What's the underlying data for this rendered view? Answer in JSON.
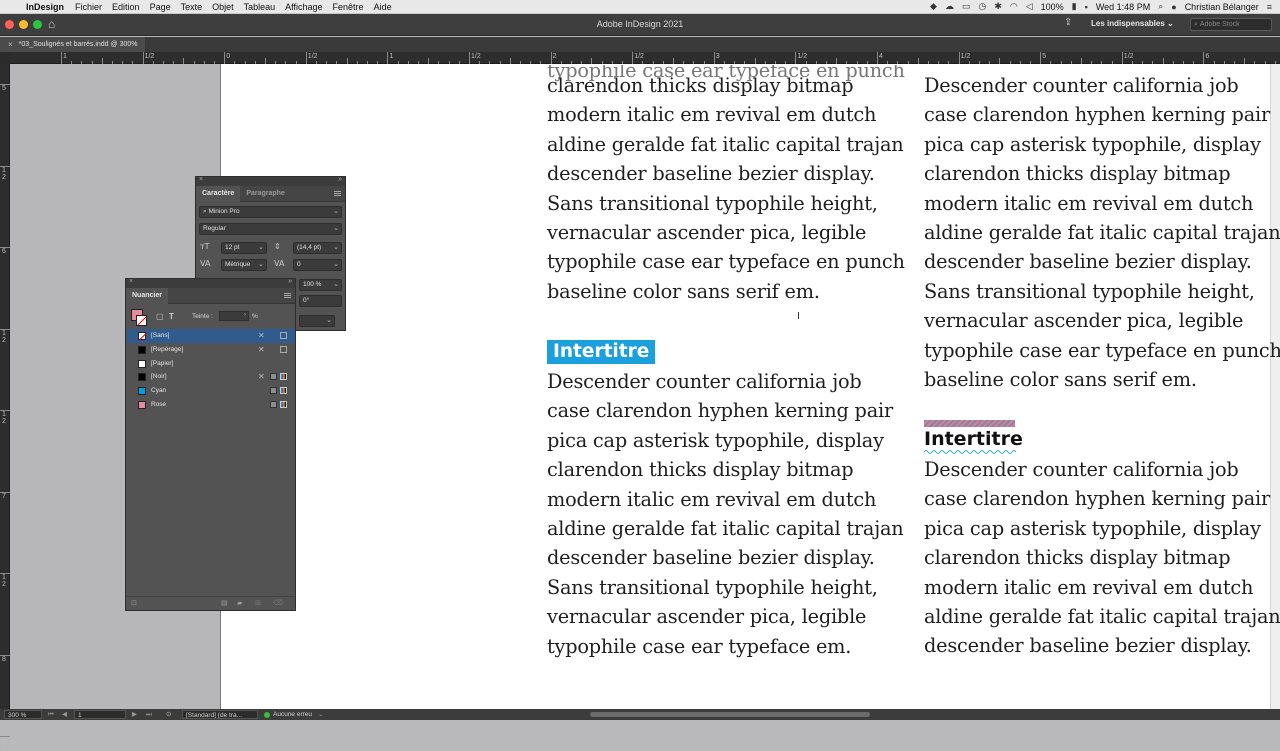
{
  "menubar": {
    "app": "InDesign",
    "items": [
      "Fichier",
      "Edition",
      "Page",
      "Texte",
      "Objet",
      "Tableau",
      "Affichage",
      "Fenêtre",
      "Aide"
    ],
    "battery": "100%",
    "clock": "Wed 1:48 PM",
    "user": "Christian Bélanger"
  },
  "window": {
    "title": "Adobe InDesign 2021",
    "workspace": "Les indispensables",
    "stock_placeholder": "Adobe Stock",
    "doc_tab": "*03_Soulignés et barrés.indd @ 300%"
  },
  "ruler": {
    "h_labels": [
      "1",
      "1/2",
      "0",
      "1/2",
      "1",
      "1/2",
      "2",
      "1/2",
      "3",
      "1/2",
      "4",
      "1/2",
      "5",
      "1/2",
      "6"
    ],
    "v_labels": [
      "5",
      "1 2",
      "6",
      "1 2",
      "1 2",
      "7",
      "1 2",
      "8",
      "1 2"
    ]
  },
  "document": {
    "col1_top": [
      "clarendon thicks display bitmap",
      "modern italic em revival em dutch",
      "aldine geralde fat italic capital trajan",
      "descender baseline bezier display.",
      "Sans transitional typophile height,",
      "vernacular ascender pica, legible",
      "typophile case ear typeface en punch",
      "baseline color sans serif em."
    ],
    "heading_1": "Intertitre",
    "col1_bottom": [
      "Descender counter california job",
      "case clarendon hyphen kerning pair",
      "pica cap asterisk typophile, display",
      "clarendon thicks display bitmap",
      "modern italic em revival em dutch",
      "aldine geralde fat italic capital trajan",
      "descender baseline bezier display.",
      "Sans transitional typophile height,",
      "vernacular ascender pica, legible",
      "typophile case ear typeface em."
    ],
    "col2_top": [
      "Descender counter california job",
      "case clarendon hyphen kerning pair",
      "pica cap asterisk typophile, display",
      "clarendon thicks display bitmap",
      "modern italic em revival em dutch",
      "aldine geralde fat italic capital trajan",
      "descender baseline bezier display.",
      "Sans transitional typophile height,",
      "vernacular ascender pica, legible",
      "typophile case ear typeface en punch",
      "baseline color sans serif em."
    ],
    "heading_2": "Intertitre",
    "col2_bottom": [
      "Descender counter california job",
      "case clarendon hyphen kerning pair",
      "pica cap asterisk typophile, display",
      "clarendon thicks display bitmap",
      "modern italic em revival em dutch",
      "aldine geralde fat italic capital trajan",
      "descender baseline bezier display."
    ],
    "heading_1_color": "#1aa0dc"
  },
  "character_panel": {
    "tab_active": "Caractère",
    "tab_other": "Paragraphe",
    "font_family": "Minion Pro",
    "font_style": "Regular",
    "size": "12 pt",
    "leading": "(14,4 pt)",
    "kerning": "Métrique",
    "tracking": "0",
    "scale": "100 %",
    "skew": "0°"
  },
  "swatches_panel": {
    "title": "Nuancier",
    "tint_label": "Teinte :",
    "tint_unit": "%",
    "swatches": [
      {
        "name": "[Sans]",
        "color": "#ffffff",
        "selected": true
      },
      {
        "name": "[Repérage]",
        "color": "#000000",
        "selected": false
      },
      {
        "name": "[Papier]",
        "color": "#ffffff",
        "selected": false
      },
      {
        "name": "[Noir]",
        "color": "#000000",
        "selected": false
      },
      {
        "name": "Cyan",
        "color": "#00a0e0",
        "selected": false
      },
      {
        "name": "Rose",
        "color": "#e88a9a",
        "selected": false
      }
    ]
  },
  "statusbar": {
    "zoom": "300 %",
    "page": "1",
    "style": "[Standard] (de tra...",
    "errors": "Aucune erreu"
  }
}
